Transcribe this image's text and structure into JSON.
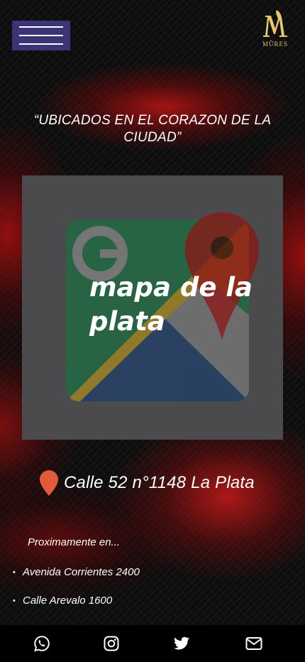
{
  "header": {
    "menu_icon": "hamburger-icon",
    "logo_letter": "M",
    "logo_text": "MÛRES"
  },
  "main": {
    "tagline": "“UBICADOS EN EL CORAZON DE LA CIUDAD”",
    "map_label": "mapa de la plata",
    "map_icon": "google-maps-icon",
    "address_icon": "location-pin-icon",
    "address": "Calle 52 n°1148 La Plata",
    "coming_soon": "Proximamente en...",
    "locations": [
      {
        "bullet": "•",
        "text": "Avenida Corrientes  2400"
      },
      {
        "bullet": "•",
        "text": "Calle Arevalo 1600"
      }
    ]
  },
  "footer": {
    "icons": [
      "whatsapp-icon",
      "instagram-icon",
      "twitter-icon",
      "email-icon"
    ]
  },
  "colors": {
    "menu_button": "#3b3577",
    "map_card": "#4b4b4d",
    "accent_red": "#e35a3a",
    "logo_gold": "#e7c56a"
  }
}
